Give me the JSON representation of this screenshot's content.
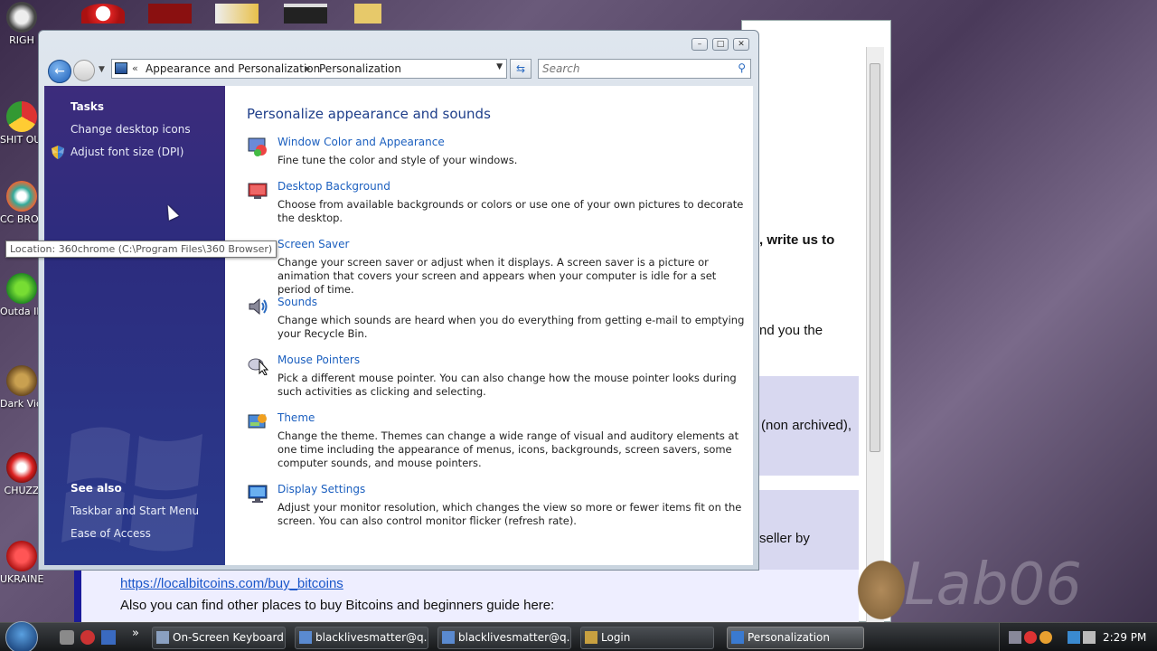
{
  "desktop": {
    "icons": [
      {
        "label": "RIGH",
        "icon": "app-icon"
      },
      {
        "label": "SHIT OUTD",
        "icon": "chrome-icon"
      },
      {
        "label": "CC BROW",
        "icon": "browser-icon"
      },
      {
        "label": "Outda IDM C",
        "icon": "idm-icon"
      },
      {
        "label": "Dark Video C",
        "icon": "video-icon"
      },
      {
        "label": "CHUZZ",
        "icon": "game-icon"
      },
      {
        "label": "UKRAINE",
        "icon": "app-icon"
      }
    ],
    "tooltip": "Location: 360chrome (C:\\Program Files\\360 Browser)",
    "watermark": "Lab06"
  },
  "background_window": {
    "fragments": [
      ", write us to",
      "nd you the",
      "(non archived),",
      "seller by"
    ],
    "link": "https://localbitcoins.com/buy_bitcoins",
    "line": "Also you can find other places to buy Bitcoins and beginners guide here:"
  },
  "window": {
    "controls": {
      "minimize": "–",
      "maximize": "□",
      "close": "✕"
    },
    "breadcrumb": {
      "overflow": "«",
      "items": [
        "Appearance and Personalization",
        "Personalization"
      ]
    },
    "search": {
      "placeholder": "Search"
    },
    "left_pane": {
      "tasks_heading": "Tasks",
      "tasks": [
        "Change desktop icons",
        "Adjust font size (DPI)"
      ],
      "see_also_heading": "See also",
      "see_also": [
        "Taskbar and Start Menu",
        "Ease of Access"
      ]
    },
    "main": {
      "title": "Personalize appearance and sounds",
      "items": [
        {
          "title": "Window Color and Appearance",
          "desc": "Fine tune the color and style of your windows.",
          "icon": "window-color-icon"
        },
        {
          "title": "Desktop Background",
          "desc": "Choose from available backgrounds or colors or use one of your own pictures to decorate the desktop.",
          "icon": "desktop-background-icon"
        },
        {
          "title": "Screen Saver",
          "desc": "Change your screen saver or adjust when it displays. A screen saver is a picture or animation that covers your screen and appears when your computer is idle for a set period of time.",
          "icon": "screen-saver-icon"
        },
        {
          "title": "Sounds",
          "desc": "Change which sounds are heard when you do everything from getting e-mail to emptying your Recycle Bin.",
          "icon": "sounds-icon"
        },
        {
          "title": "Mouse Pointers",
          "desc": "Pick a different mouse pointer. You can also change how the mouse pointer looks during such activities as clicking and selecting.",
          "icon": "mouse-pointer-icon"
        },
        {
          "title": "Theme",
          "desc": "Change the theme. Themes can change a wide range of visual and auditory elements at one time including the appearance of menus, icons, backgrounds, screen savers, some computer sounds, and mouse pointers.",
          "icon": "theme-icon"
        },
        {
          "title": "Display Settings",
          "desc": "Adjust your monitor resolution, which changes the view so more or fewer items fit on the screen. You can also control monitor flicker (refresh rate).",
          "icon": "display-settings-icon"
        }
      ]
    }
  },
  "taskbar": {
    "quicklaunch_more": "»",
    "buttons": [
      {
        "label": "On-Screen Keyboard",
        "active": false
      },
      {
        "label": "blacklivesmatter@q...",
        "active": false
      },
      {
        "label": "blacklivesmatter@q...",
        "active": false
      },
      {
        "label": "Login",
        "active": false
      },
      {
        "label": "Personalization",
        "active": true
      }
    ],
    "clock": "2:29 PM"
  },
  "colors": {
    "accent_link": "#1b5fbf",
    "title_blue": "#1e3e8a",
    "left_pane": "#2c2c7e"
  }
}
